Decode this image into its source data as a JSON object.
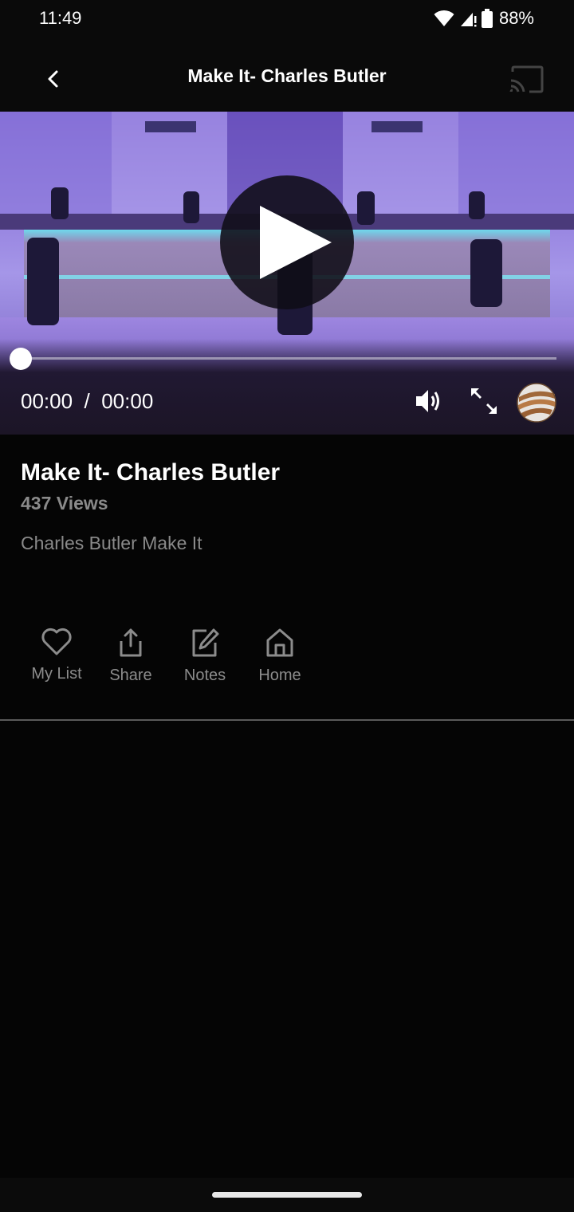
{
  "status_bar": {
    "time": "11:49",
    "battery_percent": "88%",
    "icons": [
      "wifi-icon",
      "cell-signal-icon",
      "battery-icon"
    ]
  },
  "app_bar": {
    "title": "Make It- Charles Butler",
    "back_icon": "chevron-left-icon",
    "cast_icon": "cast-icon"
  },
  "player": {
    "current_time": "00:00",
    "separator": "/",
    "duration": "00:00",
    "progress_fraction": 0.0,
    "play_icon": "play-icon",
    "volume_icon": "volume-icon",
    "fullscreen_icon": "fullscreen-icon",
    "logo_icon": "globe-logo-icon",
    "thumbnail_description": "Choir performing on purple-lit stage"
  },
  "video_info": {
    "title": "Make It- Charles Butler",
    "views": "437 Views",
    "description": "Charles Butler Make It"
  },
  "actions": [
    {
      "label": "My List",
      "icon": "heart-icon"
    },
    {
      "label": "Share",
      "icon": "share-icon"
    },
    {
      "label": "Notes",
      "icon": "edit-icon"
    },
    {
      "label": "Home",
      "icon": "home-icon"
    }
  ],
  "colors": {
    "background": "#050505",
    "muted_text": "#8a8a8a",
    "stage_purple": "#9a7fd8",
    "stage_teal": "#5ad6e6"
  }
}
